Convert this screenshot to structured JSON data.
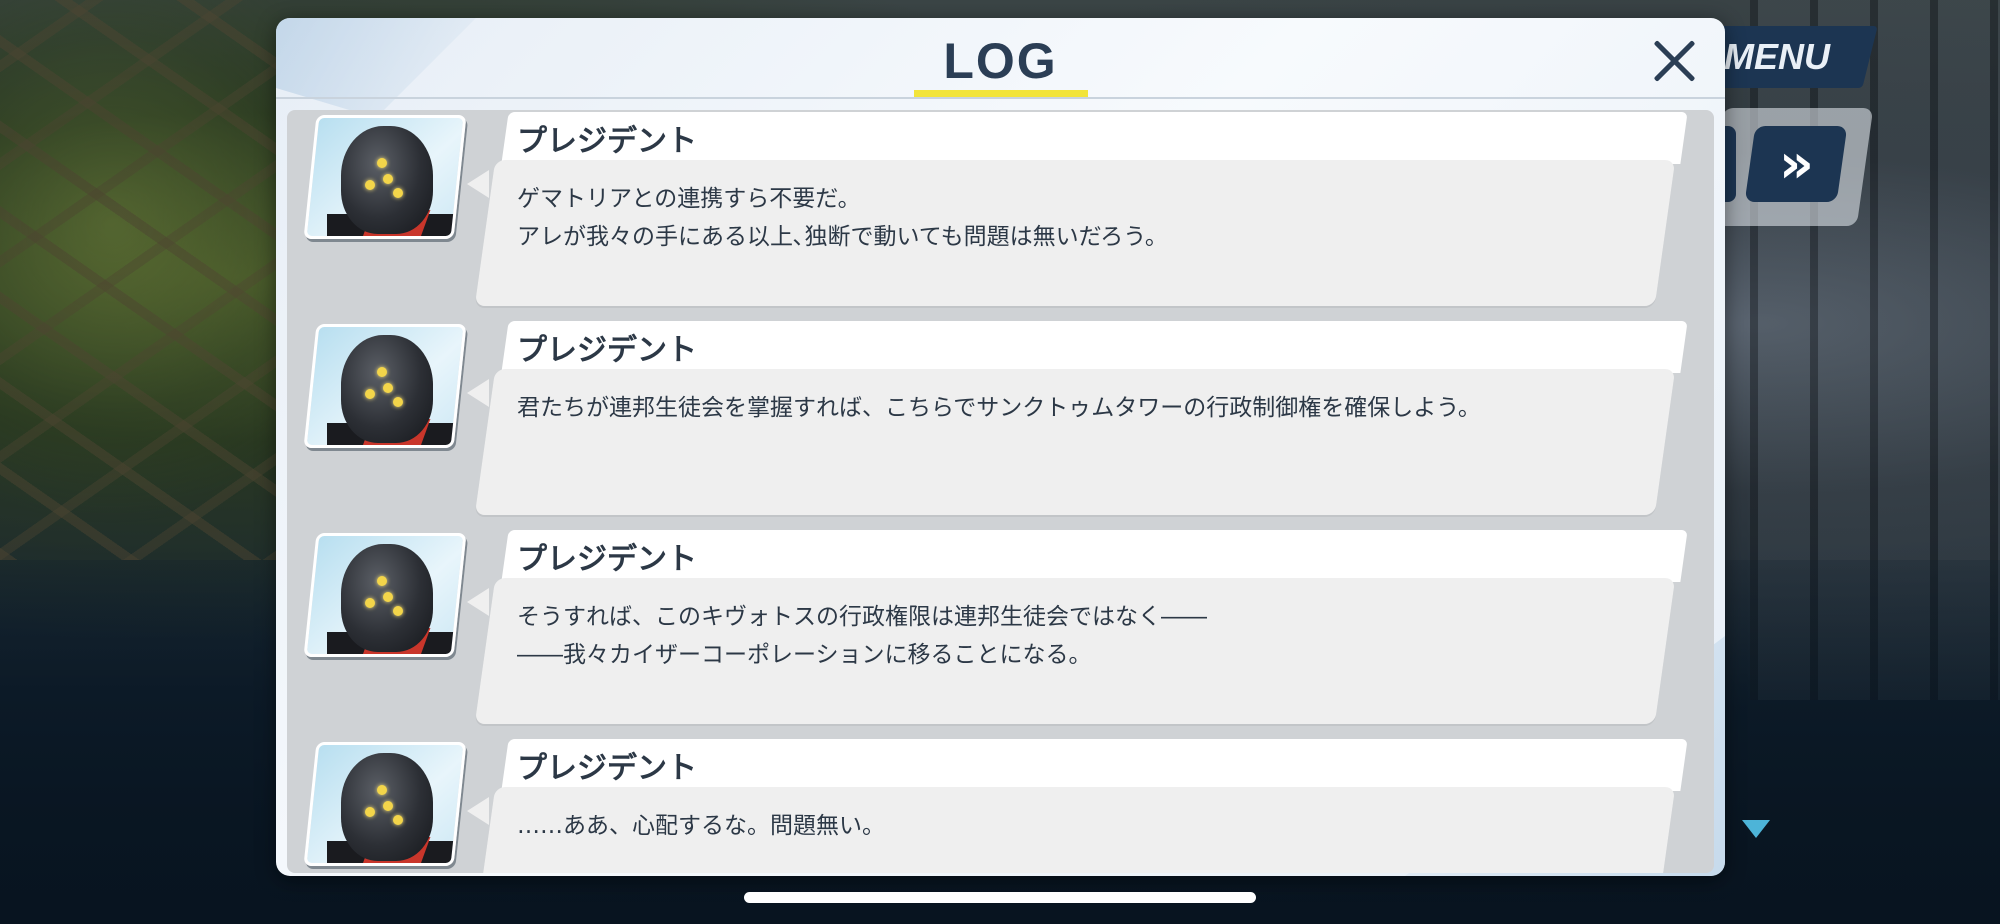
{
  "hud": {
    "menu_label": "MENU",
    "fast_forward_glyph": "»"
  },
  "log": {
    "title": "LOG",
    "close_glyph": "",
    "entries": [
      {
        "speaker": "プレジデント",
        "text": "ゲマトリアとの連携すら不要だ。\nアレが我々の手にある以上､独断で動いても問題は無いだろう。"
      },
      {
        "speaker": "プレジデント",
        "text": "君たちが連邦生徒会を掌握すれば、こちらでサンクトゥムタワーの行政制御権を確保しよう。"
      },
      {
        "speaker": "プレジデント",
        "text": "そうすれば、このキヴォトスの行政権限は連邦生徒会ではなく――\n――我々カイザーコーポレーションに移ることになる。"
      },
      {
        "speaker": "プレジデント",
        "text": "……ああ、心配するな。問題無い。"
      }
    ]
  },
  "colors": {
    "accent_yellow": "#f2e43a",
    "navy": "#1c3552",
    "title_text": "#2b3e55"
  }
}
